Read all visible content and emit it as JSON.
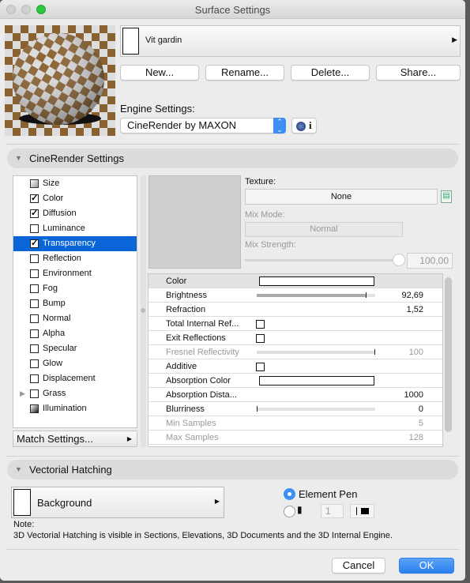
{
  "window": {
    "title": "Surface Settings"
  },
  "surface": {
    "name": "Vit gardin"
  },
  "buttons": {
    "new": "New...",
    "rename": "Rename...",
    "delete": "Delete...",
    "share": "Share..."
  },
  "engine": {
    "label": "Engine Settings:",
    "selected": "CineRender by MAXON",
    "info": "i"
  },
  "cinerender": {
    "header": "CineRender Settings",
    "channels": [
      {
        "label": "Size",
        "state": "size-icon"
      },
      {
        "label": "Color",
        "state": "checked"
      },
      {
        "label": "Diffusion",
        "state": "checked"
      },
      {
        "label": "Luminance",
        "state": "unchecked"
      },
      {
        "label": "Transparency",
        "state": "checked",
        "selected": true
      },
      {
        "label": "Reflection",
        "state": "unchecked"
      },
      {
        "label": "Environment",
        "state": "unchecked"
      },
      {
        "label": "Fog",
        "state": "unchecked"
      },
      {
        "label": "Bump",
        "state": "unchecked"
      },
      {
        "label": "Normal",
        "state": "unchecked"
      },
      {
        "label": "Alpha",
        "state": "unchecked"
      },
      {
        "label": "Specular",
        "state": "unchecked"
      },
      {
        "label": "Glow",
        "state": "unchecked"
      },
      {
        "label": "Displacement",
        "state": "unchecked"
      },
      {
        "label": "Grass",
        "state": "unchecked",
        "expandable": true
      },
      {
        "label": "Illumination",
        "state": "illumination-icon"
      }
    ],
    "match_settings": "Match Settings...",
    "texture_label": "Texture:",
    "texture_value": "None",
    "mix_mode_label": "Mix Mode:",
    "mix_mode_value": "Normal",
    "mix_strength_label": "Mix Strength:",
    "mix_strength_value": "100,00",
    "mix_strength_level": 1.0,
    "params": [
      {
        "label": "Color",
        "type": "color",
        "header": true
      },
      {
        "label": "Brightness",
        "type": "slider",
        "value": "92,69",
        "level": 0.9269
      },
      {
        "label": "Refraction",
        "type": "value",
        "value": "1,52"
      },
      {
        "label": "Total Internal Ref...",
        "type": "checkbox"
      },
      {
        "label": "Exit Reflections",
        "type": "checkbox"
      },
      {
        "label": "Fresnel Reflectivity",
        "type": "slider",
        "value": "100",
        "level": 1.0,
        "disabled": true
      },
      {
        "label": "Additive",
        "type": "checkbox"
      },
      {
        "label": "Absorption Color",
        "type": "color"
      },
      {
        "label": "Absorption Dista...",
        "type": "value",
        "value": "1000"
      },
      {
        "label": "Blurriness",
        "type": "slider",
        "value": "0",
        "level": 0
      },
      {
        "label": "Min Samples",
        "type": "value",
        "value": "5",
        "disabled": true
      },
      {
        "label": "Max Samples",
        "type": "value",
        "value": "128",
        "disabled": true
      }
    ]
  },
  "hatching": {
    "header": "Vectorial Hatching",
    "fill": "Background",
    "element_pen": "Element Pen",
    "pen_number": "1",
    "note_label": "Note:",
    "note_text": "3D Vectorial Hatching is visible in Sections, Elevations, 3D Documents and the 3D Internal Engine."
  },
  "footer": {
    "cancel": "Cancel",
    "ok": "OK"
  },
  "colors": {
    "accent": "#0a66d8",
    "ok": "#3d8ff5"
  }
}
